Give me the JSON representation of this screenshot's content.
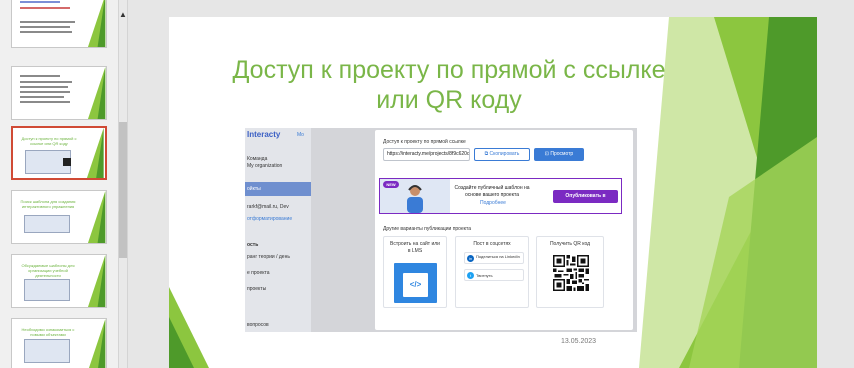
{
  "slide": {
    "title": "Доступ к проекту по прямой с ссылке или QR коду",
    "date": "13.05.2023",
    "accent": "#7ab648"
  },
  "thumbnails": [
    {
      "title": ""
    },
    {
      "title": ""
    },
    {
      "title": "Доступ к проекту по прямой с ссылке или QR коду"
    },
    {
      "title": "Поиск шаблона для создания интерактивного упражнения"
    },
    {
      "title": "Обсуждаемые шаблоны для организации учебной деятельности"
    },
    {
      "title": "Необходимо ознакомиться с новыми объектами"
    }
  ],
  "screenshot": {
    "brand": "Interacty",
    "nav_label": "Mo",
    "team_label": "Команда",
    "org_name": "My organization",
    "side_items": [
      "ойкты",
      "rarkf@mail.ru, Dev",
      "отформатирование",
      "ость",
      "ранг теории / день",
      "е проекта",
      "проекты",
      "вопросов"
    ],
    "copy_label": "Доступ к проекту по прямой ссылке",
    "url_value": "https://interacty.me/projects/8f9c620dbed401/c",
    "copy_button": "Скопировать",
    "preview_button": "Просмотр",
    "new_badge": "NEW",
    "banner_text": "Создайте публичный шаблон на основе вашего проекта",
    "banner_link": "Подробнее",
    "publish_button": "Опубликовать в Сообществе",
    "options_label": "Другие варианты публикации проекта",
    "embed_card_title": "Встроить на сайт или в LMS",
    "social_card_title": "Пост в соцсетях",
    "linkedin_label": "Поделиться на LinkedIn",
    "twitter_label": "Твитнуть",
    "qr_card_title": "Получить QR код",
    "embed_icon": "</>",
    "side_number": "0",
    "colors": {
      "primary": "#3a7bd5",
      "purple": "#7b2ac2"
    }
  }
}
